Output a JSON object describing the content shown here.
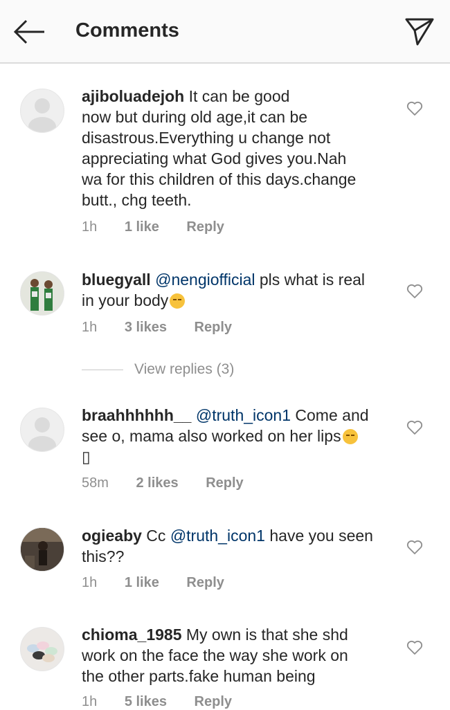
{
  "header": {
    "title": "Comments"
  },
  "comments": [
    {
      "username": "ajiboluadejoh",
      "text": " It can be good\nnow but during old age,it can be\ndisastrous.Everything u change not\nappreciating what God gives you.Nah\nwa for this children of this days.change\nbutt., chg teeth.",
      "time": "1h",
      "likes": "1 like",
      "reply": "Reply"
    },
    {
      "username": "bluegyall",
      "mention": "@nengiofficial",
      "text": " pls what is real\nin your body",
      "time": "1h",
      "likes": "3 likes",
      "reply": "Reply"
    },
    {
      "username": "braahhhhhh__",
      "mention": "@truth_icon1",
      "text": " Come and\nsee o, mama also worked on her lips",
      "extra": "▯",
      "time": "58m",
      "likes": "2 likes",
      "reply": "Reply"
    },
    {
      "username": "ogieaby",
      "pre": " Cc ",
      "mention": "@truth_icon1",
      "text": " have you seen\nthis??",
      "time": "1h",
      "likes": "1 like",
      "reply": "Reply"
    },
    {
      "username": "chioma_1985",
      "text": " My own is that she shd\nwork on the face the way she work on\nthe other parts.fake human being",
      "time": "1h",
      "likes": "5 likes",
      "reply": "Reply"
    }
  ],
  "view_replies": "View replies (3)",
  "icons": {
    "back": "arrow-left-icon",
    "send": "paper-plane-icon",
    "like": "heart-outline-icon"
  },
  "colors": {
    "mention": "#003569",
    "meta": "#8e8e8e",
    "header_bg": "#fafafa"
  }
}
